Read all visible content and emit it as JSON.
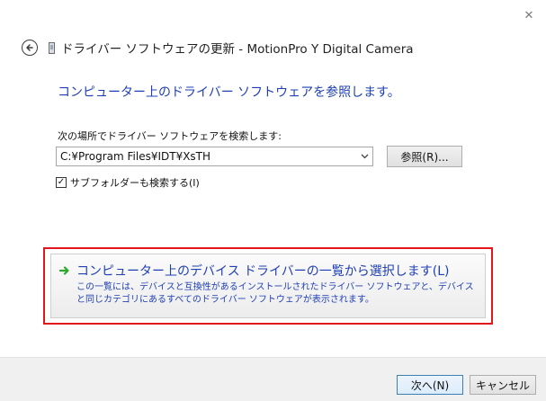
{
  "window": {
    "close_glyph": "✕",
    "title": "ドライバー ソフトウェアの更新 - MotionPro Y Digital Camera"
  },
  "main": {
    "heading": "コンピューター上のドライバー ソフトウェアを参照します。",
    "search_label": "次の場所でドライバー ソフトウェアを検索します:",
    "path_value": "C:¥Program Files¥IDT¥XsTH",
    "browse_label": "参照(R)...",
    "include_subfolders": {
      "checked": true,
      "check_glyph": "✓",
      "label": "サブフォルダーも検索する(I)"
    },
    "pick_option": {
      "title": "コンピューター上のデバイス ドライバーの一覧から選択します(L)",
      "description": "この一覧には、デバイスと互換性があるインストールされたドライバー ソフトウェアと、デバイスと同じカテゴリにあるすべてのドライバー ソフトウェアが表示されます。"
    }
  },
  "footer": {
    "next_label": "次へ(N)",
    "cancel_label": "キャンセル"
  },
  "icons": {
    "back": "back-arrow-icon",
    "device": "device-icon",
    "dropdown": "chevron-down-icon",
    "option_arrow": "green-arrow-icon"
  },
  "colors": {
    "link_blue": "#1f3fb5",
    "highlight_red": "#e4161c",
    "arrow_green": "#2da82d",
    "footer_bg": "#f0f0f0"
  }
}
